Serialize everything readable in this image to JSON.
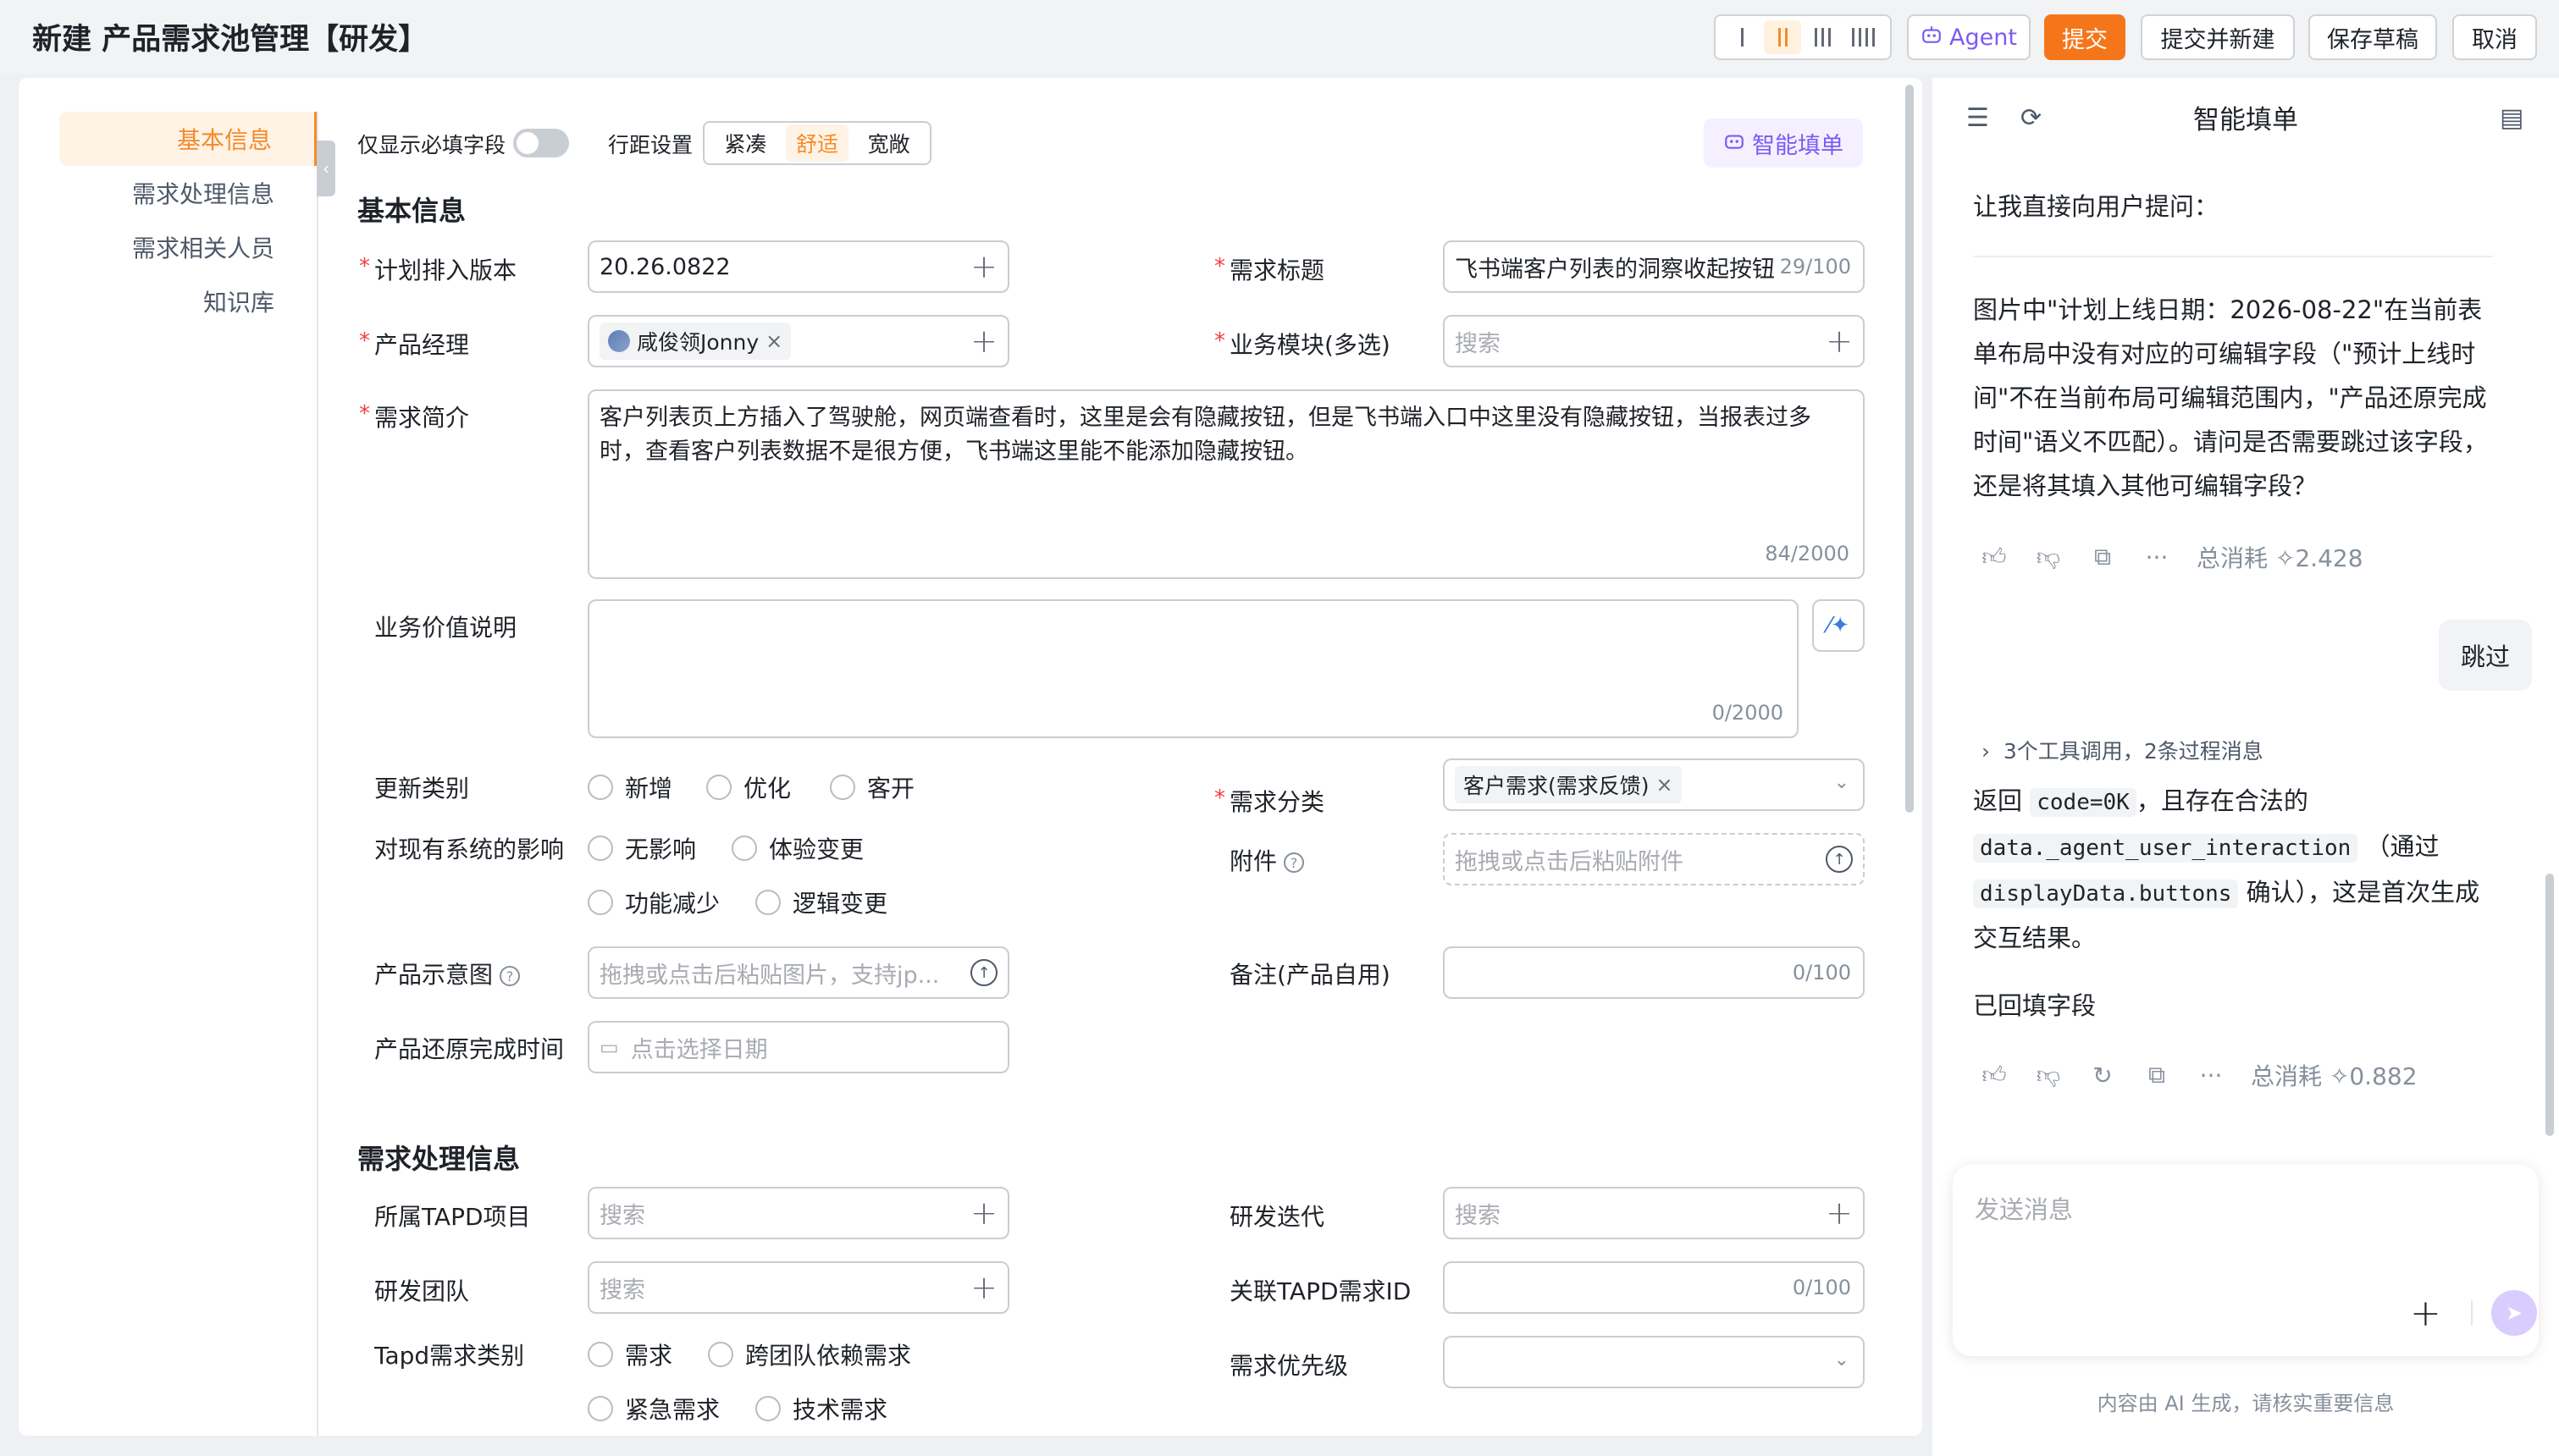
{
  "header": {
    "title": "新建 产品需求池管理【研发】",
    "agent_label": "Agent",
    "submit_label": "提交",
    "submit_new_label": "提交并新建",
    "draft_label": "保存草稿",
    "cancel_label": "取消",
    "layout_options": [
      "1-column",
      "2-column",
      "3-column",
      "4-column"
    ],
    "layout_selected": "2-column",
    "accent_color": "#f5761a"
  },
  "nav": {
    "items": [
      "基本信息",
      "需求处理信息",
      "需求相关人员",
      "知识库"
    ],
    "active": "基本信息"
  },
  "toolbar": {
    "required_only_label": "仅显示必填字段",
    "required_only_on": false,
    "density_label": "行距设置",
    "density_options": [
      "紧凑",
      "舒适",
      "宽敞"
    ],
    "density_selected": "舒适",
    "smart_fill_label": "智能填单"
  },
  "basic": {
    "section_title": "基本信息",
    "plan_version": {
      "label": "计划排入版本",
      "value": "20.26.0822"
    },
    "req_title": {
      "label": "需求标题",
      "value": "飞书端客户列表的洞察收起按钮",
      "count": "29/100"
    },
    "pm": {
      "label": "产品经理",
      "tag": "咸俊领Jonny"
    },
    "module": {
      "label": "业务模块(多选)",
      "placeholder": "搜索"
    },
    "intro": {
      "label": "需求简介",
      "value": "客户列表页上方插入了驾驶舱，网页端查看时，这里是会有隐藏按钮，但是飞书端入口中这里没有隐藏按钮，当报表过多时，查看客户列表数据不是很方便，飞书端这里能不能添加隐藏按钮。",
      "count": "84/2000"
    },
    "value_desc": {
      "label": "业务价值说明",
      "count": "0/2000"
    },
    "update_type": {
      "label": "更新类别",
      "options": [
        "新增",
        "优化",
        "客开"
      ]
    },
    "category": {
      "label": "需求分类",
      "tag": "客户需求(需求反馈)"
    },
    "impact": {
      "label": "对现有系统的影响",
      "options": [
        "无影响",
        "体验变更",
        "功能减少",
        "逻辑变更"
      ]
    },
    "attachment": {
      "label": "附件",
      "placeholder": "拖拽或点击后粘贴附件"
    },
    "mockup": {
      "label": "产品示意图",
      "placeholder": "拖拽或点击后粘贴图片，支持jp..."
    },
    "remark": {
      "label": "备注(产品自用)",
      "count": "0/100"
    },
    "restore_time": {
      "label": "产品还原完成时间",
      "placeholder": "点击选择日期"
    }
  },
  "process": {
    "section_title": "需求处理信息",
    "tapd_project": {
      "label": "所属TAPD项目",
      "placeholder": "搜索"
    },
    "iteration": {
      "label": "研发迭代",
      "placeholder": "搜索"
    },
    "team": {
      "label": "研发团队",
      "placeholder": "搜索"
    },
    "tapd_id": {
      "label": "关联TAPD需求ID",
      "count": "0/100"
    },
    "tapd_type": {
      "label": "Tapd需求类别",
      "options": [
        "需求",
        "跨团队依赖需求",
        "紧急需求",
        "技术需求"
      ]
    },
    "priority": {
      "label": "需求优先级"
    }
  },
  "chat": {
    "title": "智能填单",
    "msg1": "让我直接向用户提问：",
    "msg2": "图片中\"计划上线日期：2026-08-22\"在当前表单布局中没有对应的可编辑字段（\"预计上线时间\"不在当前布局可编辑范围内，\"产品还原完成时间\"语义不匹配）。请问是否需要跳过该字段，还是将其填入其他可编辑字段？",
    "cost1": "总消耗 ✧2.428",
    "user_reply": "跳过",
    "tool_calls": "3个工具调用，2条过程消息",
    "msg3_a": "返回",
    "msg3_code1": "code=0K",
    "msg3_b": "，且存在合法的",
    "msg3_code2": "data._agent_user_interaction",
    "msg3_c": "（通过",
    "msg3_code3": "displayData.buttons",
    "msg3_d": "确认），这是首次生成交互结果。",
    "msg4": "已回填字段",
    "cost2": "总消耗 ✧0.882",
    "input_placeholder": "发送消息",
    "disclaimer": "内容由 AI 生成，请核实重要信息"
  }
}
